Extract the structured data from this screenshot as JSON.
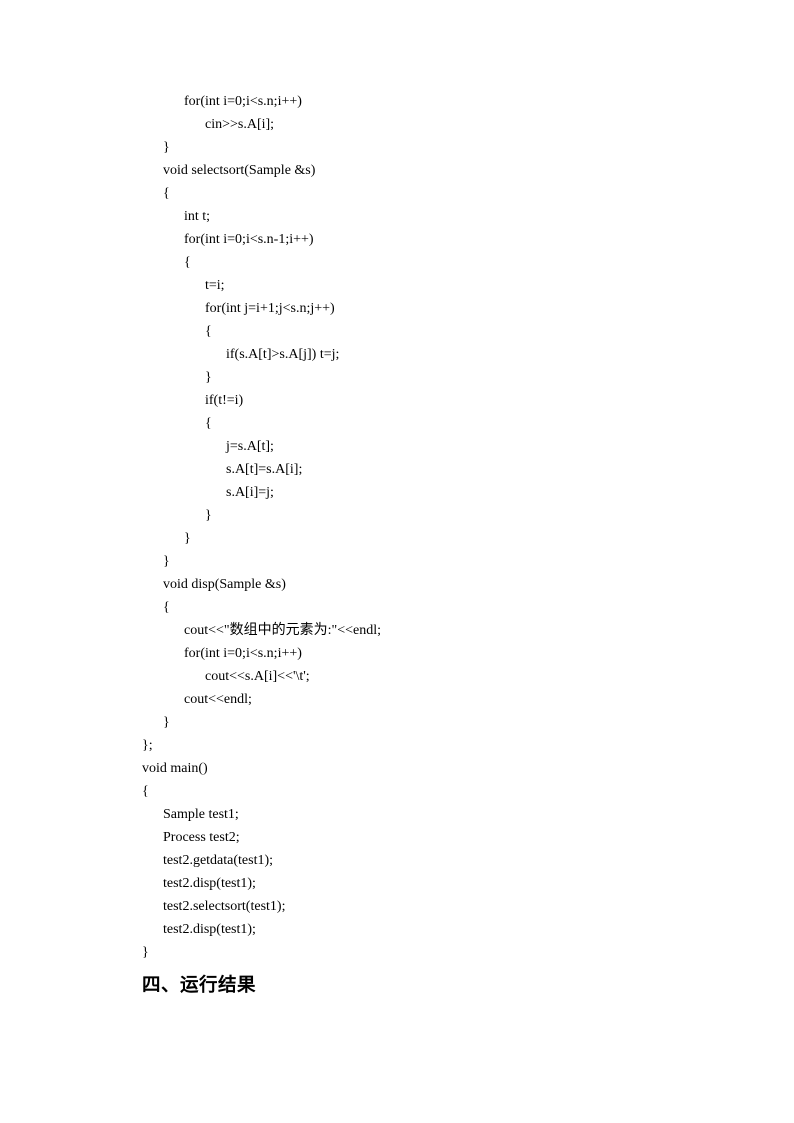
{
  "code": {
    "lines": [
      "            for(int i=0;i<s.n;i++)",
      "                  cin>>s.A[i];",
      "      }",
      "      void selectsort(Sample &s)",
      "      {",
      "            int t;",
      "            for(int i=0;i<s.n-1;i++)",
      "            {",
      "                  t=i;",
      "                  for(int j=i+1;j<s.n;j++)",
      "                  {",
      "                        if(s.A[t]>s.A[j]) t=j;",
      "                  }",
      "                  if(t!=i)",
      "                  {",
      "                        j=s.A[t];",
      "                        s.A[t]=s.A[i];",
      "                        s.A[i]=j;",
      "                  }",
      "            }",
      "      }",
      "      void disp(Sample &s)",
      "      {",
      "            cout<<\"数组中的元素为:\"<<endl;",
      "            for(int i=0;i<s.n;i++)",
      "                  cout<<s.A[i]<<'\\t';",
      "            cout<<endl;",
      "      }",
      "};",
      "void main()",
      "{",
      "      Sample test1;",
      "      Process test2;",
      "      test2.getdata(test1);",
      "      test2.disp(test1);",
      "      test2.selectsort(test1);",
      "      test2.disp(test1);",
      "}"
    ]
  },
  "heading": "四、运行结果"
}
